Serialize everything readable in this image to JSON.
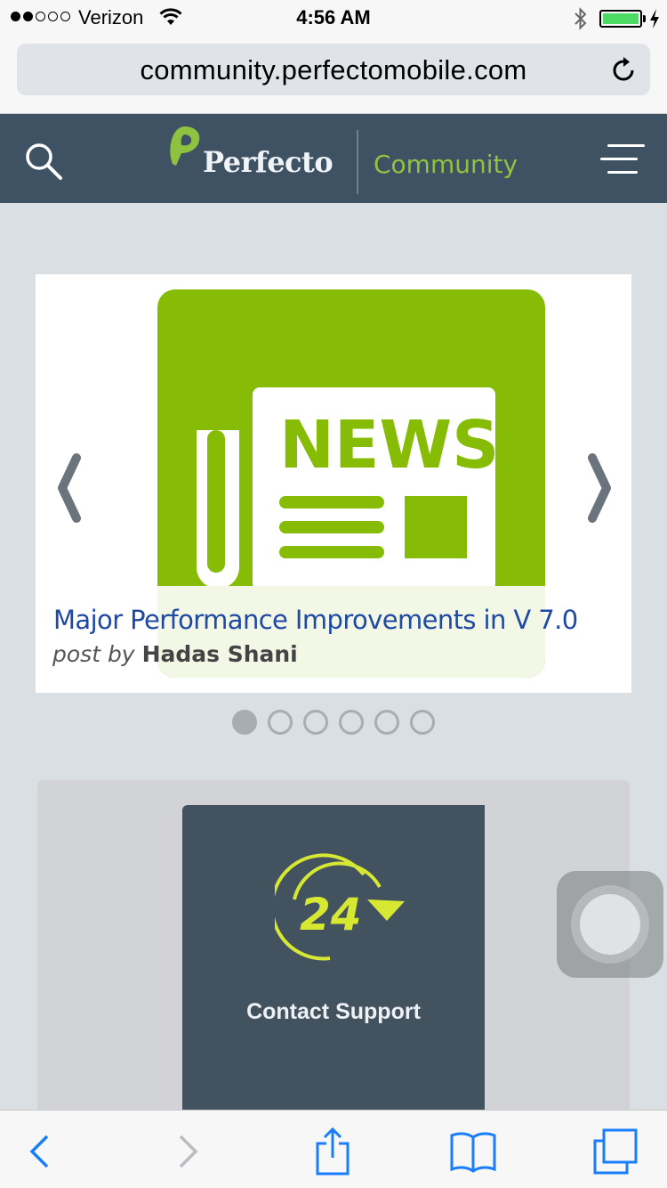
{
  "status_bar": {
    "carrier": "Verizon",
    "time": "4:56 AM",
    "signal_bars_filled": 2,
    "signal_bars_total": 5,
    "battery_level": 1.0,
    "battery_color": "#4cd964"
  },
  "browser": {
    "url": "community.perfectomobile.com",
    "reload_icon": "reload-icon"
  },
  "site_header": {
    "logo_text": "Perfecto",
    "logo_subtext": "Community",
    "accent_color": "#8fc33f",
    "background_color": "#3f5264"
  },
  "carousel": {
    "image_icon": "news-icon",
    "image_text": "NEWS",
    "image_color": "#86bc05",
    "title": "Major Performance Improvements in V 7.0",
    "meta_prefix": "post by",
    "author": "Hadas Shani",
    "slide_count": 6,
    "active_slide": 1
  },
  "support_card": {
    "icon_text": "24",
    "label": "Contact Support"
  },
  "toolbar": {
    "items": [
      "back",
      "forward",
      "share",
      "bookmarks",
      "tabs"
    ]
  }
}
